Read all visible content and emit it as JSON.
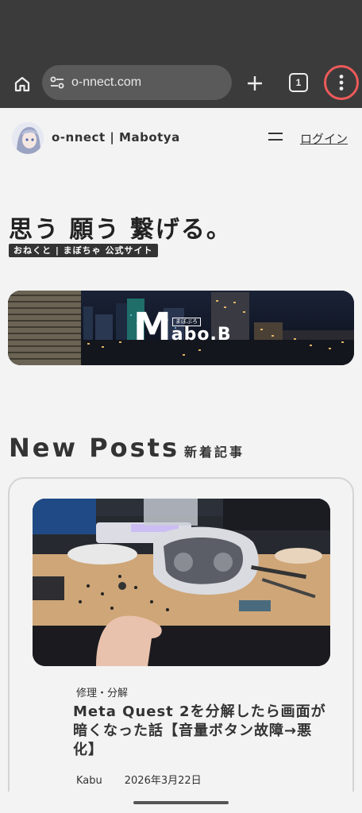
{
  "browser": {
    "url": "o-nnect.com",
    "tab_count": "1",
    "colors": {
      "chrome": "#3b3b3b",
      "url_bar": "#5a5a5a",
      "highlight_ring": "#ee5a5a"
    },
    "icons": [
      "home-icon",
      "tune-icon",
      "plus-icon",
      "tab-switcher-icon",
      "more-vert-icon"
    ]
  },
  "site": {
    "name": "o-nnect | Mabotya",
    "login": "ログイン"
  },
  "hero": {
    "title": "思う 願う 繋げる。",
    "badge": "おねくと | まぼちゃ 公式サイト"
  },
  "banner": {
    "logo_m": "M",
    "logo_rest": "abo.B",
    "logo_sub": "まぼぶろ"
  },
  "new_posts": {
    "title_en": "New Posts",
    "title_ja": "新着記事",
    "posts": [
      {
        "category": "修理・分解",
        "title": "Meta Quest 2を分解したら画面が暗くなった話【音量ボタン故障→悪化】",
        "author": "Kabu",
        "date": "2026年3月22日"
      }
    ]
  }
}
